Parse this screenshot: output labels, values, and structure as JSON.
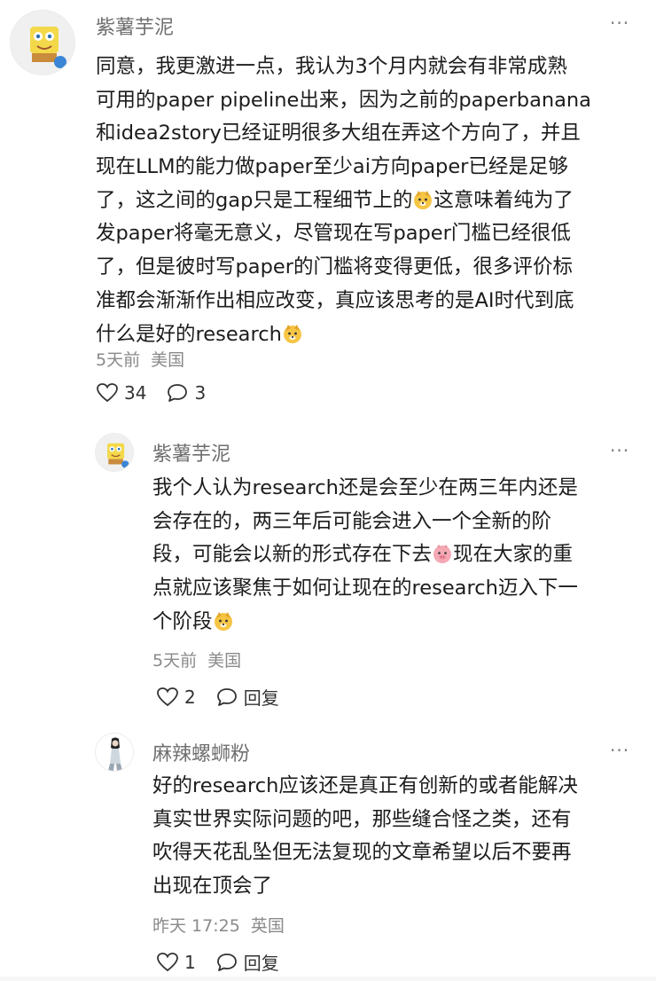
{
  "comments": [
    {
      "author": "紫薯芋泥",
      "more_label": "···",
      "lines": [
        "同意，我更激进一点，我认为3个月内就会有非常成熟",
        "可用的paper pipeline出来，因为之前的paperbanana",
        "和idea2story已经证明很多大组在弄这个方向了，并且",
        "现在LLM的能力做paper至少ai方向paper已经是足够",
        "了，这之间的gap只是工程细节上的",
        "这意味着纯为了",
        "发paper将毫无意义，尽管现在写paper门槛已经很低",
        "了，但是彼时写paper的门槛将变得更低，很多评价标",
        "准都会渐渐作出相应改变，真应该思考的是AI时代到底",
        "什么是好的research"
      ],
      "time": "5天前",
      "location": "美国",
      "likes": "34",
      "replies": "3"
    },
    {
      "author": "紫薯芋泥",
      "more_label": "···",
      "lines": [
        "我个人认为research还是会至少在两三年内还是",
        "会存在的，两三年后可能会进入一个全新的阶",
        "段，可能会以新的形式存在下去",
        "现在大家的重",
        "点就应该聚焦于如何让现在的research迈入下一",
        "个阶段"
      ],
      "time": "5天前",
      "location": "美国",
      "likes": "2",
      "reply_label": "回复"
    },
    {
      "author": "麻辣螺蛳粉",
      "more_label": "···",
      "lines": [
        "好的research应该还是真正有创新的或者能解决",
        "真实世界实际问题的吧，那些缝合怪之类，还有",
        "吹得天花乱坠但无法复现的文章希望以后不要再",
        "出现在顶会了"
      ],
      "time": "昨天 17:25",
      "location": "英国",
      "likes": "1",
      "reply_label": "回复"
    }
  ],
  "icons": {
    "heart": "heart-outline-icon",
    "bubble": "chat-bubble-icon",
    "more": "more-dots-icon",
    "emoji_doge": "doge-emoji",
    "emoji_pig": "pig-face-emoji"
  },
  "colors": {
    "text": "#1c1c1c",
    "secondary": "#6f6f6f",
    "meta": "#8a8a8a",
    "emoji_yellow": "#f6c544",
    "emoji_pink": "#f4a9b4"
  }
}
